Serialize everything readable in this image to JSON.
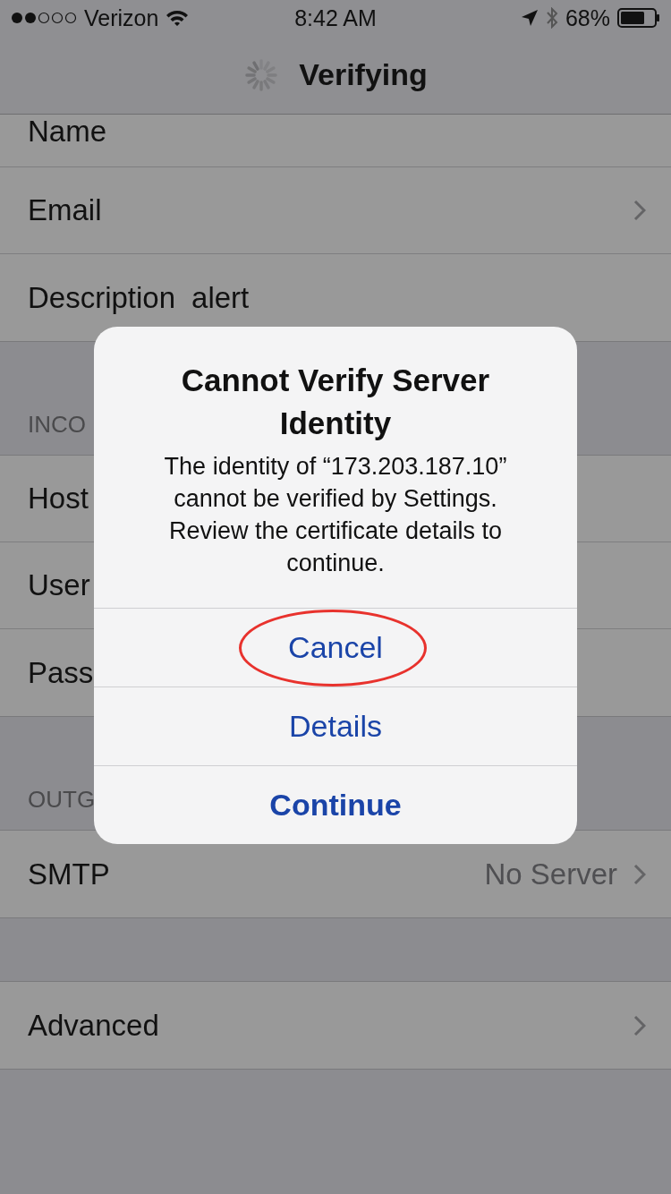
{
  "status_bar": {
    "carrier": "Verizon",
    "time": "8:42 AM",
    "battery": "68%"
  },
  "nav_bar": {
    "title": "Verifying",
    "loading": true
  },
  "sections": [
    {
      "rows": [
        {
          "label": "Name",
          "value": null,
          "chevron": false,
          "kind": "partial"
        },
        {
          "label": "Email",
          "value": null,
          "chevron": true
        },
        {
          "label": "Description",
          "value": "alert",
          "chevron": false
        }
      ]
    },
    {
      "header": "INCO",
      "rows": [
        {
          "label": "Host",
          "value": null,
          "chevron": false
        },
        {
          "label": "User",
          "value": null,
          "chevron": false
        },
        {
          "label": "Pass",
          "value": null,
          "chevron": false
        }
      ]
    },
    {
      "header": "OUTG",
      "rows": [
        {
          "label": "SMTP",
          "value": "No Server",
          "chevron": true
        }
      ]
    },
    {
      "rows": [
        {
          "label": "Advanced",
          "value": null,
          "chevron": true
        }
      ]
    }
  ],
  "alert": {
    "title": "Cannot Verify Server Identity",
    "message": "The identity of “173.203.187.10” cannot be verified by Settings. Review the certificate details to continue.",
    "buttons": [
      {
        "label": "Cancel",
        "bold": false,
        "circled": true
      },
      {
        "label": "Details",
        "bold": false,
        "circled": false
      },
      {
        "label": "Continue",
        "bold": true,
        "circled": false
      }
    ]
  }
}
